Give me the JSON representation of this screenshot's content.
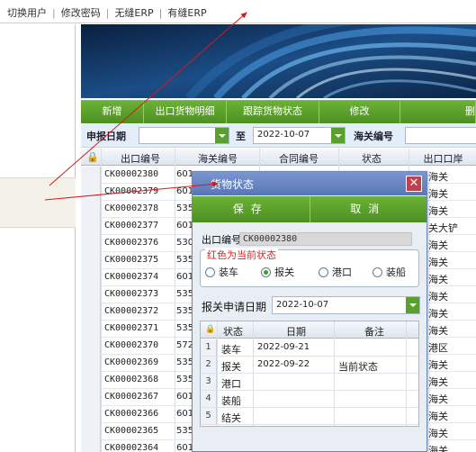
{
  "topbar": {
    "links": [
      "切换用户",
      "修改密码",
      "无缝ERP",
      "有缝ERP"
    ]
  },
  "toolbar": {
    "buttons": [
      "新增",
      "出口货物明细",
      "跟踪货物状态",
      "修改",
      "删"
    ]
  },
  "search": {
    "date_label": "申报日期",
    "date_from": "",
    "to_label": "至",
    "date_to": "2022-10-07",
    "customs_label": "海关编号",
    "customs_value": ""
  },
  "grid": {
    "columns": [
      "出口编号",
      "海关编号",
      "合同编号",
      "状态",
      "出口口岸"
    ],
    "rows": [
      {
        "code": "CK00002380",
        "customs": "601",
        "port": "海关"
      },
      {
        "code": "CK00002379",
        "customs": "601",
        "port": "海关"
      },
      {
        "code": "CK00002378",
        "customs": "535",
        "port": "海关"
      },
      {
        "code": "CK00002377",
        "customs": "601",
        "port": "关大铲"
      },
      {
        "code": "CK00002376",
        "customs": "530",
        "port": "海关"
      },
      {
        "code": "CK00002375",
        "customs": "535",
        "port": "海关"
      },
      {
        "code": "CK00002374",
        "customs": "601",
        "port": "海关"
      },
      {
        "code": "CK00002373",
        "customs": "535",
        "port": "海关"
      },
      {
        "code": "CK00002372",
        "customs": "535",
        "port": "海关"
      },
      {
        "code": "CK00002371",
        "customs": "535",
        "port": "海关"
      },
      {
        "code": "CK00002370",
        "customs": "572",
        "port": "港区"
      },
      {
        "code": "CK00002369",
        "customs": "535",
        "port": "海关"
      },
      {
        "code": "CK00002368",
        "customs": "535",
        "port": "海关"
      },
      {
        "code": "CK00002367",
        "customs": "601",
        "port": "海关"
      },
      {
        "code": "CK00002366",
        "customs": "601",
        "port": "海关"
      },
      {
        "code": "CK00002365",
        "customs": "535",
        "port": "海关"
      },
      {
        "code": "CK00002364",
        "customs": "601",
        "port": "海关"
      }
    ]
  },
  "dialog": {
    "title": "货物状态",
    "save_label": "保存",
    "cancel_label": "取消",
    "export_no_label": "出口编号:",
    "export_no_value": "CK00002380",
    "legend": "红色为当前状态",
    "options": [
      "装车",
      "报关",
      "港口",
      "装船"
    ],
    "selected_option": "报关",
    "decl_date_label": "报关申请日期",
    "decl_date_value": "2022-10-07",
    "table_columns": [
      "状态",
      "日期",
      "备注"
    ],
    "table_rows": [
      {
        "n": "1",
        "status": "装车",
        "date": "2022-09-21",
        "note": ""
      },
      {
        "n": "2",
        "status": "报关",
        "date": "2022-09-22",
        "note": "当前状态"
      },
      {
        "n": "3",
        "status": "港口",
        "date": "",
        "note": ""
      },
      {
        "n": "4",
        "status": "装船",
        "date": "",
        "note": ""
      },
      {
        "n": "5",
        "status": "结关",
        "date": "",
        "note": ""
      }
    ]
  },
  "colors": {
    "accent_green": "#5a9e2a",
    "dialog_title_blue": "#5876b7",
    "arrow_red": "#d11a1a",
    "legend_red": "#dd2222"
  }
}
